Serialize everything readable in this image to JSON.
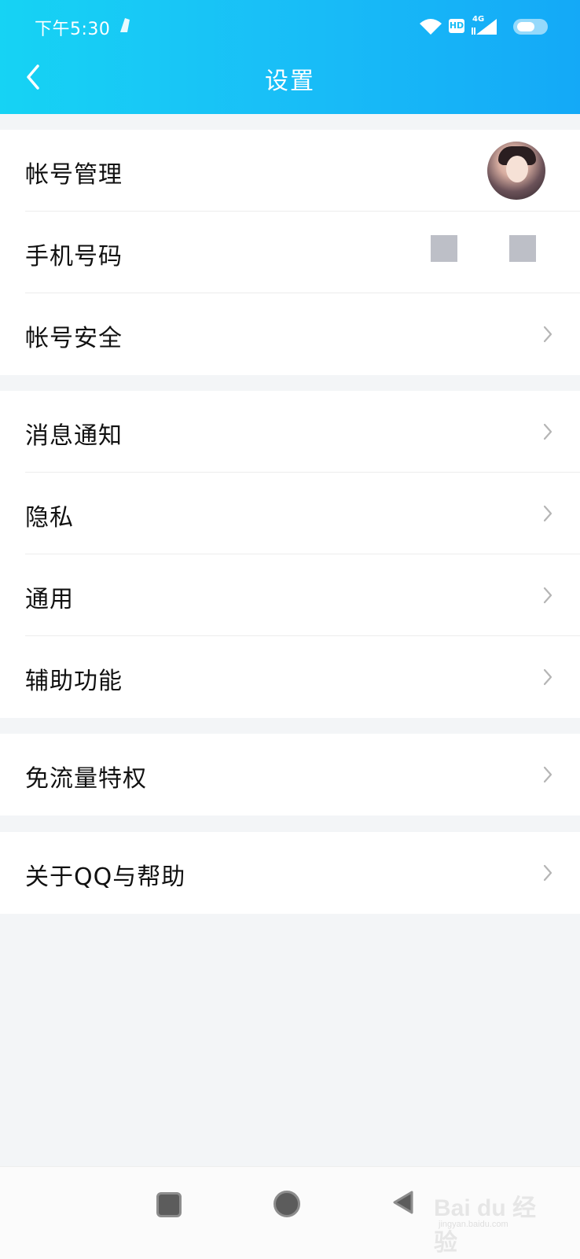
{
  "status_bar": {
    "time": "下午5:30",
    "hd_badge": "HD",
    "network": "4G"
  },
  "header": {
    "title": "设置"
  },
  "settings_groups": [
    {
      "items": [
        {
          "label": "帐号管理"
        },
        {
          "label": "手机号码"
        },
        {
          "label": "帐号安全"
        }
      ]
    },
    {
      "items": [
        {
          "label": "消息通知"
        },
        {
          "label": "隐私"
        },
        {
          "label": "通用"
        },
        {
          "label": "辅助功能"
        }
      ]
    },
    {
      "items": [
        {
          "label": "免流量特权"
        }
      ]
    },
    {
      "items": [
        {
          "label": "关于QQ与帮助"
        }
      ]
    }
  ],
  "watermark": {
    "brand": "Bai du 经验",
    "url": "jingyan.baidu.com"
  },
  "colors": {
    "header_start": "#16d3f4",
    "header_end": "#14a9f7",
    "background": "#f3f5f7"
  }
}
